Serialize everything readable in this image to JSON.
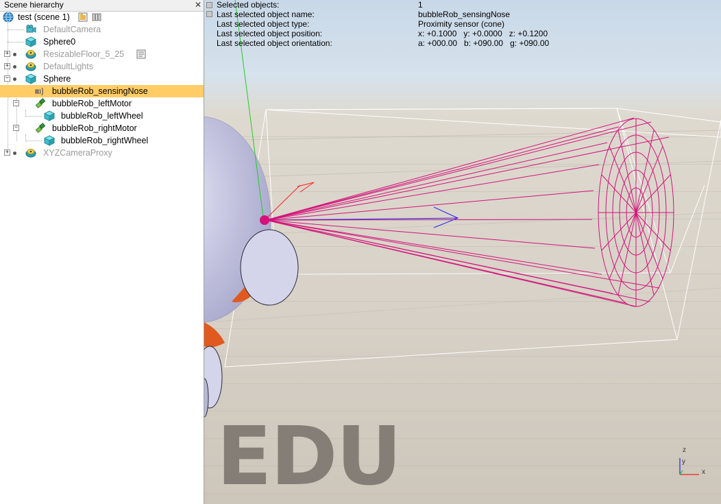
{
  "hierarchy": {
    "title": "Scene hierarchy",
    "close_glyph": "✕",
    "items": [
      {
        "label": "test (scene 1)",
        "icon": "globe-icon",
        "dim": false
      },
      {
        "label": "DefaultCamera",
        "icon": "camera-icon",
        "dim": true
      },
      {
        "label": "Sphere0",
        "icon": "shape-cube-icon",
        "dim": false
      },
      {
        "label": "ResizableFloor_5_25",
        "icon": "dummy-icon",
        "dim": true
      },
      {
        "label": "DefaultLights",
        "icon": "dummy-icon",
        "dim": true
      },
      {
        "label": "Sphere",
        "icon": "shape-cube-icon",
        "dim": false
      },
      {
        "label": "bubbleRob_sensingNose",
        "icon": "proximity-sensor-icon",
        "dim": false,
        "selected": true
      },
      {
        "label": "bubbleRob_leftMotor",
        "icon": "joint-icon",
        "dim": false
      },
      {
        "label": "bubbleRob_leftWheel",
        "icon": "shape-cube-icon",
        "dim": false
      },
      {
        "label": "bubbleRob_rightMotor",
        "icon": "joint-icon",
        "dim": false
      },
      {
        "label": "bubbleRob_rightWheel",
        "icon": "shape-cube-icon",
        "dim": false
      },
      {
        "label": "XYZCameraProxy",
        "icon": "dummy-icon",
        "dim": true
      }
    ]
  },
  "info": {
    "rows": [
      {
        "label": "Selected objects:",
        "value": "1"
      },
      {
        "label": "Last selected object name:",
        "value": "bubbleRob_sensingNose"
      },
      {
        "label": "Last selected object type:",
        "value": "Proximity sensor (cone)"
      },
      {
        "label": "Last selected object position:",
        "value": "x: +0.1000   y: +0.0000   z: +0.1200"
      },
      {
        "label": "Last selected object orientation:",
        "value": "a: +000.00   b: +090.00   g: +090.00"
      }
    ]
  },
  "viewport": {
    "watermark": "EDU",
    "axes": {
      "x": "x",
      "y": "y",
      "z": "z"
    }
  },
  "colors": {
    "selection": "#ffcc66",
    "sensor": "#d4127a",
    "sky": "#c8d8e8",
    "floor": "#d8d2c8",
    "robot_body": "#c9c9e6",
    "robot_accent": "#e05a20"
  }
}
